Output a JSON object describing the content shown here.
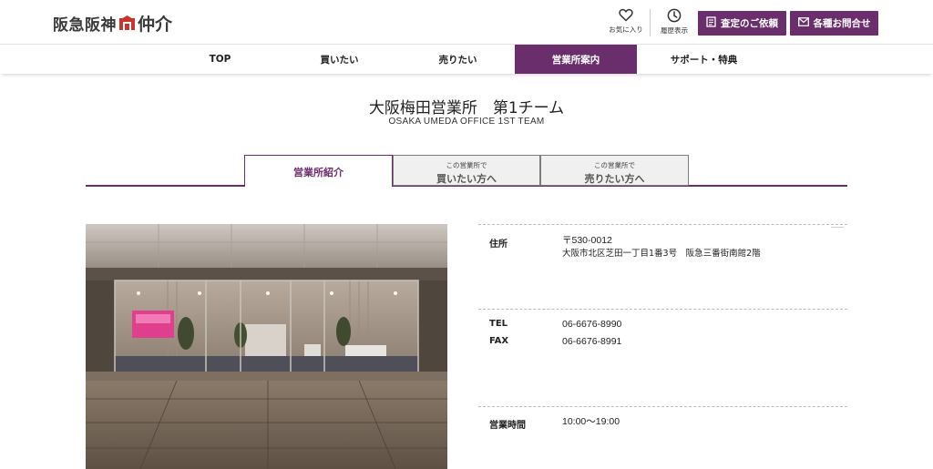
{
  "header": {
    "logo_part1": "阪急阪神",
    "logo_part2": "仲介",
    "favorites_label": "お気に入り",
    "history_label": "履歴表示",
    "appraisal_button": "査定のご依頼",
    "inquiry_button": "各種お問合せ",
    "brand_color": "#6b2e6c"
  },
  "nav": {
    "items": [
      {
        "label": "TOP"
      },
      {
        "label": "買いたい"
      },
      {
        "label": "売りたい"
      },
      {
        "label": "営業所案内"
      },
      {
        "label": "サポート・特典"
      }
    ]
  },
  "page": {
    "title": "大阪梅田営業所　第1チーム",
    "subtitle": "OSAKA UMEDA OFFICE 1ST TEAM"
  },
  "tabs": [
    {
      "small": "",
      "big": "営業所紹介"
    },
    {
      "small": "この営業所で",
      "big": "買いたい方へ"
    },
    {
      "small": "この営業所で",
      "big": "売りたい方へ"
    }
  ],
  "info": {
    "address_label": "住所",
    "postal": "〒530-0012",
    "address": "大阪市北区芝田一丁目1番3号　阪急三番街南館2階",
    "tel_label": "TEL",
    "tel": "06-6676-8990",
    "fax_label": "FAX",
    "fax": "06-6676-8991",
    "hours_label": "営業時間",
    "hours": "10:00〜19:00"
  }
}
